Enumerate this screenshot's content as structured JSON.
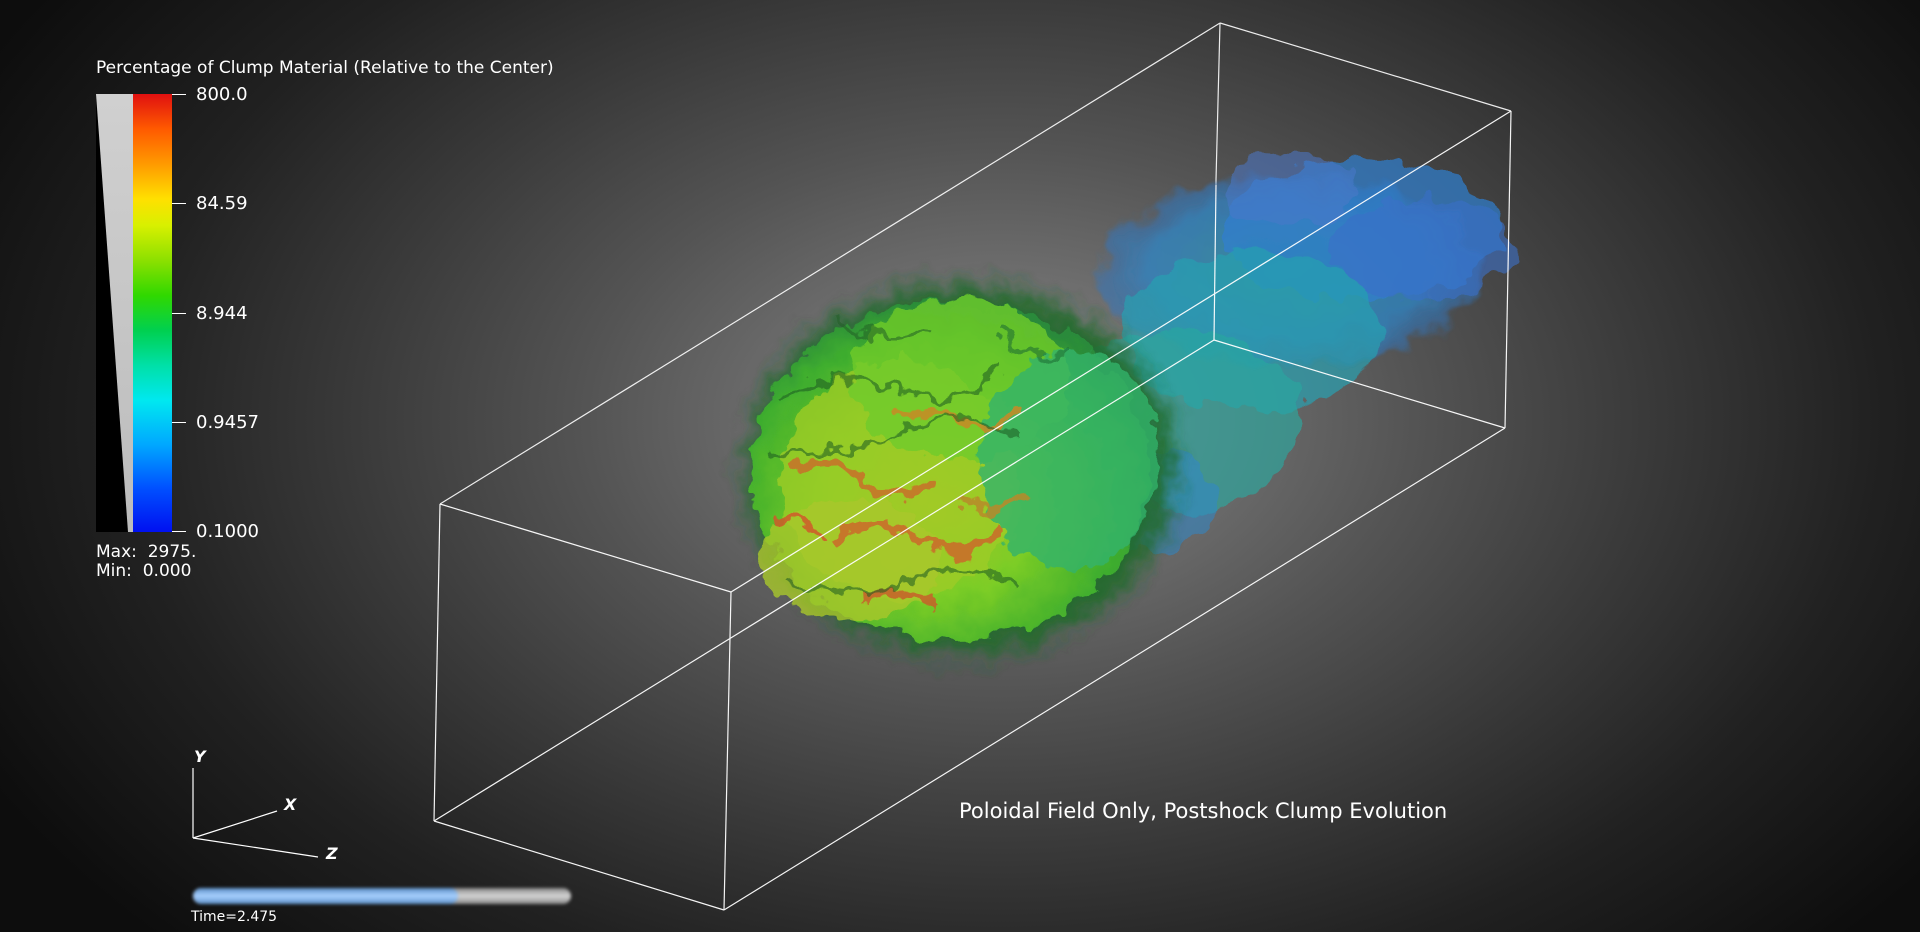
{
  "legend": {
    "title": "Percentage of Clump Material (Relative to the Center)",
    "ticks": [
      "800.0",
      "84.59",
      "8.944",
      "0.9457",
      "0.1000"
    ],
    "max_label": "Max:",
    "max_value": "2975.",
    "min_label": "Min:",
    "min_value": "0.000",
    "colormap": [
      "#e01010",
      "#ff9a00",
      "#ffe000",
      "#30d800",
      "#00e8f0",
      "#0050ff",
      "#0010f0"
    ]
  },
  "caption": "Poloidal Field Only, Postshock Clump Evolution",
  "axes": {
    "y": "Y",
    "x": "X",
    "z": "Z"
  },
  "time": {
    "label": "Time=2.475",
    "progress": 0.7
  },
  "colors": {
    "clump_core": "#7ccd26",
    "clump_hot": "#c9702a",
    "tail": "#2f86c8",
    "box_lines": "#ffffff"
  }
}
